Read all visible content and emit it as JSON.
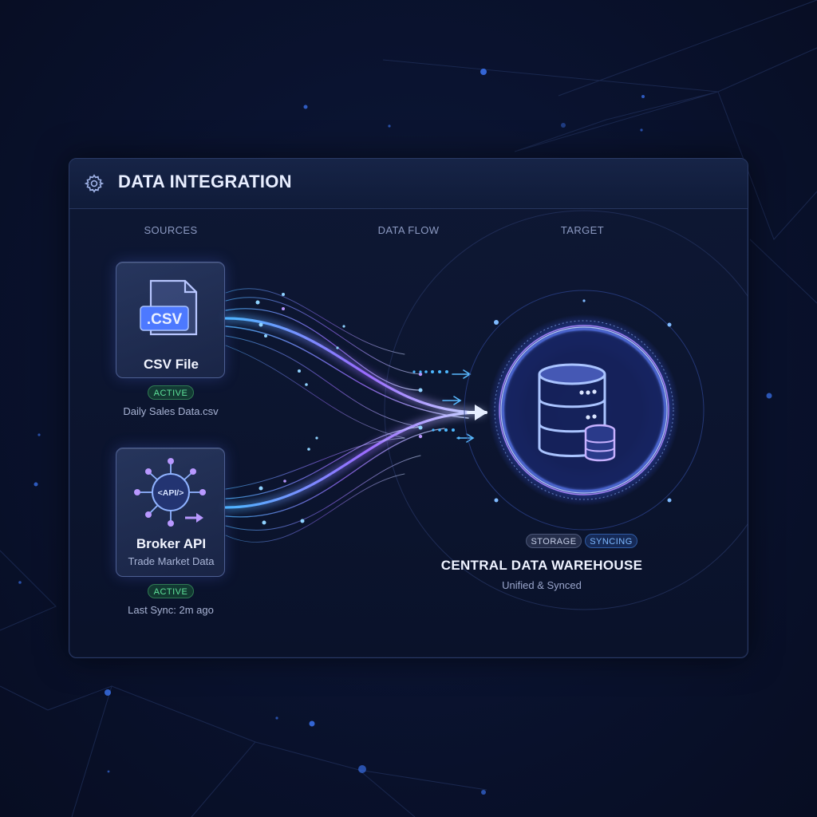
{
  "panel": {
    "title": "DATA INTEGRATION"
  },
  "columns": {
    "sources": "SOURCES",
    "flow": "DATA FLOW",
    "target": "TARGET"
  },
  "sources": [
    {
      "icon": "csv-file-icon",
      "icon_text": ".CSV",
      "title": "CSV File",
      "status": "ACTIVE",
      "caption": "Daily Sales Data.csv"
    },
    {
      "icon": "api-network-icon",
      "icon_text": "<API/>",
      "title": "Broker API",
      "subtitle": "Trade Market Data",
      "status": "ACTIVE",
      "caption": "Last Sync: 2m ago"
    }
  ],
  "target": {
    "icon": "database-icon",
    "badges": [
      "STORAGE",
      "SYNCING"
    ],
    "title": "CENTRAL DATA WAREHOUSE",
    "subtitle": "Unified & Synced"
  },
  "colors": {
    "background": "#0a1330",
    "accent_blue": "#4db8ff",
    "accent_purple": "#9a6bff",
    "active_green": "#5ee39a",
    "syncing_blue": "#7db8ff"
  }
}
